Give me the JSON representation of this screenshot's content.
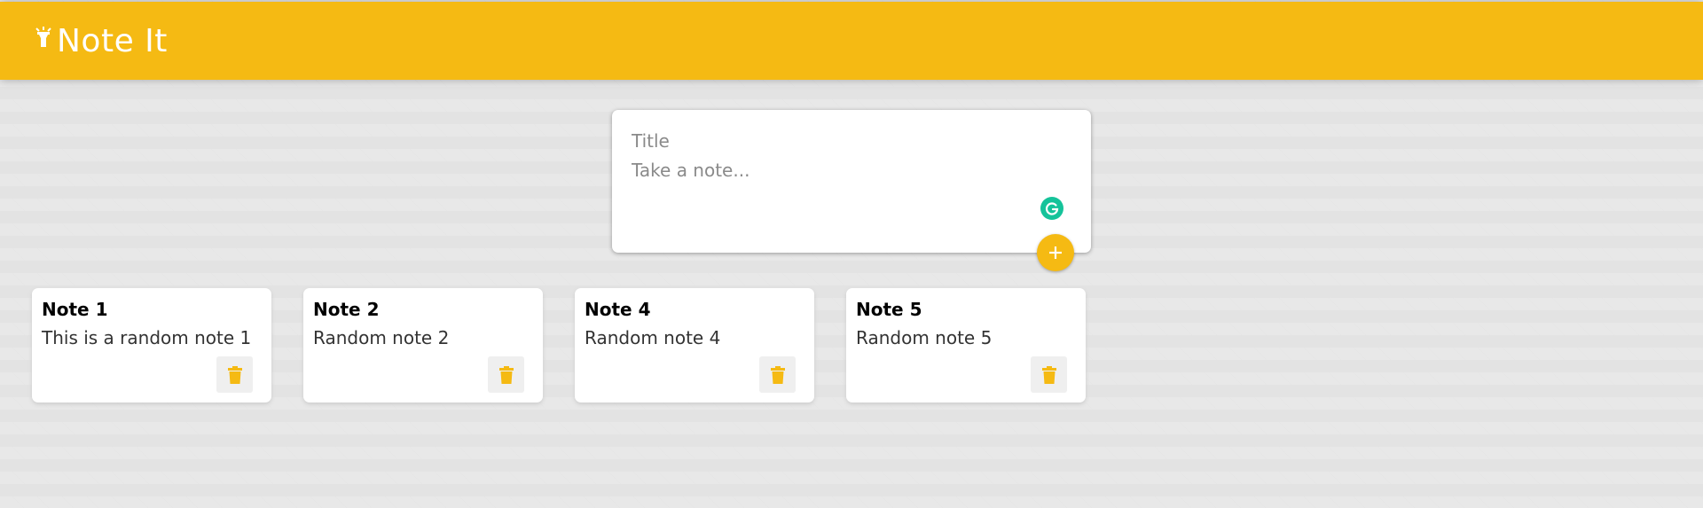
{
  "header": {
    "title": "Note It",
    "logo_icon": "flashlight-icon"
  },
  "create": {
    "title_placeholder": "Title",
    "content_placeholder": "Take a note...",
    "add_icon": "plus-icon"
  },
  "notes": [
    {
      "title": "Note 1",
      "content": "This is a random note 1"
    },
    {
      "title": "Note 2",
      "content": "Random note 2"
    },
    {
      "title": "Note 4",
      "content": "Random note 4"
    },
    {
      "title": "Note 5",
      "content": "Random note 5"
    }
  ],
  "colors": {
    "accent": "#f5ba13",
    "background": "#e3e3e3",
    "grammarly": "#15c39a"
  }
}
